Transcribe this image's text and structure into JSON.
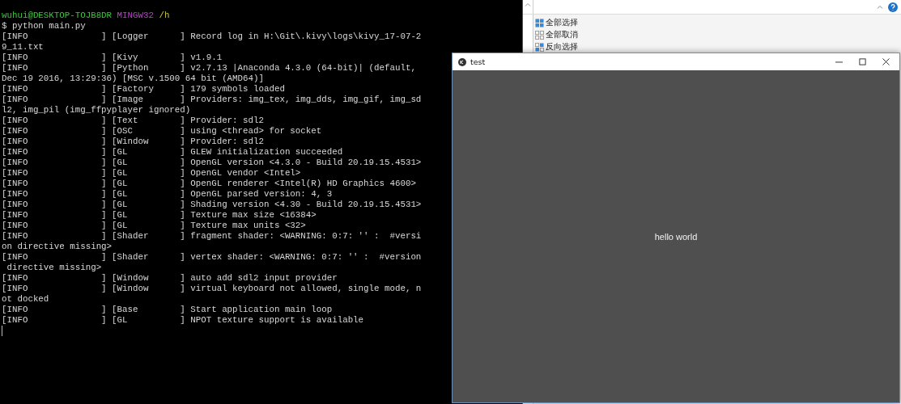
{
  "terminal": {
    "prompt": [
      {
        "kind": "user",
        "text": "wuhui@DESKTOP-TOJB8DR"
      },
      {
        "kind": "system",
        "text": "MINGW32"
      },
      {
        "kind": "path",
        "text": "/h"
      }
    ],
    "lines": [
      "$ python main.py",
      "[INFO              ] [Logger      ] Record log in H:\\Git\\.kivy\\logs\\kivy_17-07-2",
      "9_11.txt",
      "[INFO              ] [Kivy        ] v1.9.1",
      "[INFO              ] [Python      ] v2.7.13 |Anaconda 4.3.0 (64-bit)| (default,",
      "Dec 19 2016, 13:29:36) [MSC v.1500 64 bit (AMD64)]",
      "[INFO              ] [Factory     ] 179 symbols loaded",
      "[INFO              ] [Image       ] Providers: img_tex, img_dds, img_gif, img_sd",
      "l2, img_pil (img_ffpyplayer ignored)",
      "[INFO              ] [Text        ] Provider: sdl2",
      "[INFO              ] [OSC         ] using <thread> for socket",
      "[INFO              ] [Window      ] Provider: sdl2",
      "[INFO              ] [GL          ] GLEW initialization succeeded",
      "[INFO              ] [GL          ] OpenGL version <4.3.0 - Build 20.19.15.4531>",
      "[INFO              ] [GL          ] OpenGL vendor <Intel>",
      "[INFO              ] [GL          ] OpenGL renderer <Intel(R) HD Graphics 4600>",
      "[INFO              ] [GL          ] OpenGL parsed version: 4, 3",
      "[INFO              ] [GL          ] Shading version <4.30 - Build 20.19.15.4531>",
      "[INFO              ] [GL          ] Texture max size <16384>",
      "[INFO              ] [GL          ] Texture max units <32>",
      "[INFO              ] [Shader      ] fragment shader: <WARNING: 0:7: '' :  #versi",
      "on directive missing>",
      "[INFO              ] [Shader      ] vertex shader: <WARNING: 0:7: '' :  #version",
      " directive missing>",
      "[INFO              ] [Window      ] auto add sdl2 input provider",
      "[INFO              ] [Window      ] virtual keyboard not allowed, single mode, n",
      "ot docked",
      "[INFO              ] [Base        ] Start application main loop",
      "[INFO              ] [GL          ] NPOT texture support is available"
    ]
  },
  "explorer": {
    "ribbon_items": [
      {
        "kind": "select-all",
        "label": "全部选择"
      },
      {
        "kind": "select-none",
        "label": "全部取消"
      },
      {
        "kind": "invert",
        "label": "反向选择"
      }
    ]
  },
  "app_window": {
    "title": "test",
    "body_text": "hello world"
  }
}
